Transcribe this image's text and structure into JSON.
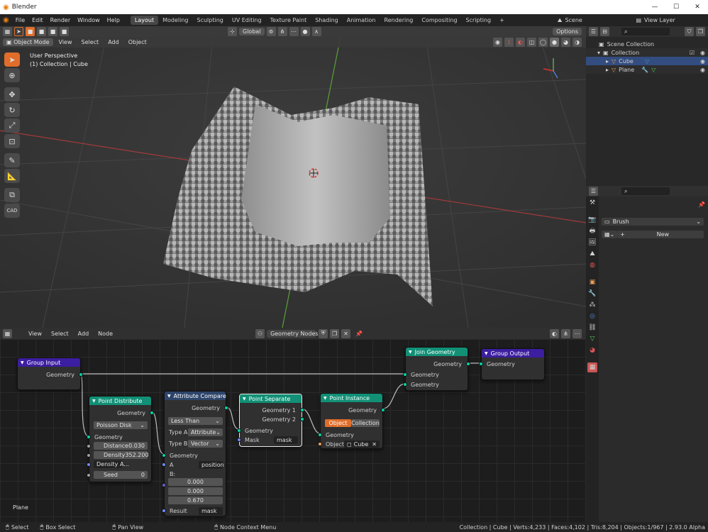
{
  "window": {
    "title": "Blender",
    "min": "—",
    "max": "☐",
    "close": "✕"
  },
  "menu": [
    "File",
    "Edit",
    "Render",
    "Window",
    "Help"
  ],
  "workspaces": [
    "Layout",
    "Modeling",
    "Sculpting",
    "UV Editing",
    "Texture Paint",
    "Shading",
    "Animation",
    "Rendering",
    "Compositing",
    "Scripting"
  ],
  "add_ws": "+",
  "scene": "Scene",
  "view_layer": "View Layer",
  "viewport": {
    "mode": "Object Mode",
    "menus": [
      "View",
      "Select",
      "Add",
      "Object"
    ],
    "orientation": "Global",
    "options": "Options",
    "perspective": "User Perspective",
    "collection_info": "(1) Collection | Cube",
    "cad_label": "CAD"
  },
  "node_editor": {
    "menus": [
      "View",
      "Select",
      "Add",
      "Node"
    ],
    "tree_name": "Geometry Nodes",
    "object_label": "Plane",
    "nodes": {
      "group_input": {
        "title": "Group Input",
        "out": "Geometry"
      },
      "join": {
        "title": "Join Geometry",
        "out": "Geometry",
        "in1": "Geometry",
        "in2": "Geometry"
      },
      "group_output": {
        "title": "Group Output",
        "in": "Geometry"
      },
      "distribute": {
        "title": "Point Distribute",
        "out": "Geometry",
        "method": "Poisson Disk",
        "in": "Geometry",
        "distance_label": "Distance",
        "distance": "0.030",
        "density_label": "Density",
        "density": "352.200",
        "density_attr": "Density A...",
        "seed_label": "Seed",
        "seed": "0"
      },
      "compare": {
        "title": "Attribute Compare",
        "out": "Geometry",
        "op": "Less Than",
        "typea_label": "Type A:",
        "typea": "Attribute",
        "typeb_label": "Type B:",
        "typeb": "Vector",
        "in": "Geometry",
        "a_label": "A",
        "a": "position",
        "b_label": "B:",
        "b": [
          "0.000",
          "0.000",
          "0.670"
        ],
        "result_label": "Result",
        "result": "mask"
      },
      "separate": {
        "title": "Point Separate",
        "out1": "Geometry 1",
        "out2": "Geometry 2",
        "in": "Geometry",
        "mask_label": "Mask",
        "mask": "mask"
      },
      "instance": {
        "title": "Point Instance",
        "out": "Geometry",
        "mode_obj": "Object",
        "mode_col": "Collection",
        "in": "Geometry",
        "obj_label": "Object:",
        "obj": "Cube"
      }
    }
  },
  "outliner": {
    "root": "Scene Collection",
    "collection": "Collection",
    "items": [
      "Cube",
      "Plane"
    ]
  },
  "properties": {
    "brush": "Brush",
    "new": "New"
  },
  "status": {
    "select": "Select",
    "box": "Box Select",
    "pan": "Pan View",
    "ctx": "Node Context Menu",
    "stats": "Collection | Cube | Verts:4,233 | Faces:4,102 | Tris:8,204 | Objects:1/967 | 2.93.0 Alpha"
  },
  "colors": {
    "accent": "#e06d2a",
    "selected_row": "#334d80",
    "geometry_socket": "#00d6a3",
    "vector_socket": "#6e8cff"
  }
}
